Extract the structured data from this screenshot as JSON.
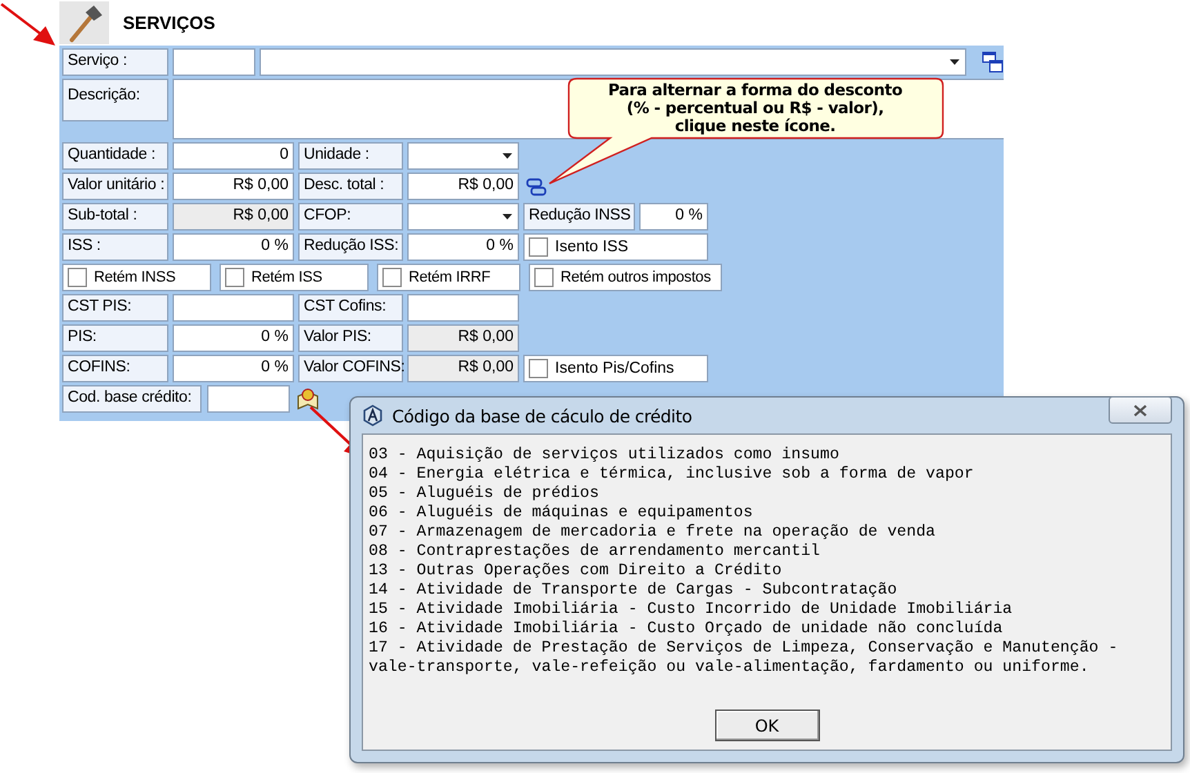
{
  "header": {
    "title": "SERVIÇOS"
  },
  "service": {
    "label": "Serviço :"
  },
  "description": {
    "label": "Descrição:"
  },
  "rows": [
    {
      "kind": "fields",
      "cells": [
        {
          "kind": "label",
          "text": "Quantidade :"
        },
        {
          "kind": "input",
          "value": "0"
        },
        {
          "kind": "label",
          "text": "Unidade :"
        },
        {
          "kind": "select"
        }
      ]
    },
    {
      "kind": "fields",
      "cells": [
        {
          "kind": "label",
          "text": "Valor unitário :"
        },
        {
          "kind": "input",
          "value": "R$ 0,00"
        },
        {
          "kind": "label",
          "text": "Desc. total :"
        },
        {
          "kind": "input",
          "value": "R$ 0,00"
        },
        {
          "kind": "toggle"
        }
      ]
    },
    {
      "kind": "fields",
      "cells": [
        {
          "kind": "label",
          "text": "Sub-total :"
        },
        {
          "kind": "readonly",
          "value": "R$ 0,00"
        },
        {
          "kind": "label",
          "text": "CFOP:"
        },
        {
          "kind": "select"
        },
        {
          "kind": "label",
          "text": "Redução INSS"
        },
        {
          "kind": "input",
          "value": "0 %"
        }
      ]
    },
    {
      "kind": "fields",
      "cells": [
        {
          "kind": "label",
          "text": "ISS :"
        },
        {
          "kind": "input",
          "value": "0 %"
        },
        {
          "kind": "label",
          "text": "Redução ISS:"
        },
        {
          "kind": "input",
          "value": "0 %"
        },
        {
          "kind": "checkbox",
          "text": "Isento ISS",
          "checked": false
        }
      ]
    },
    {
      "kind": "checks",
      "items": [
        {
          "text": "Retém INSS",
          "checked": false
        },
        {
          "text": "Retém ISS",
          "checked": false
        },
        {
          "text": "Retém IRRF",
          "checked": false
        },
        {
          "text": "Retém outros impostos",
          "checked": false
        }
      ]
    },
    {
      "kind": "fields",
      "cells": [
        {
          "kind": "label",
          "text": "CST PIS:"
        },
        {
          "kind": "input"
        },
        {
          "kind": "label",
          "text": "CST Cofins:"
        },
        {
          "kind": "input"
        }
      ]
    },
    {
      "kind": "fields",
      "cells": [
        {
          "kind": "label",
          "text": "PIS:"
        },
        {
          "kind": "input",
          "value": "0 %"
        },
        {
          "kind": "label",
          "text": "Valor PIS:"
        },
        {
          "kind": "readonly",
          "value": "R$ 0,00"
        }
      ]
    },
    {
      "kind": "fields",
      "cells": [
        {
          "kind": "label",
          "text": "COFINS:"
        },
        {
          "kind": "input",
          "value": "0 %"
        },
        {
          "kind": "label",
          "text": "Valor COFINS:"
        },
        {
          "kind": "readonly",
          "value": "R$ 0,00"
        },
        {
          "kind": "checkbox",
          "text": "Isento Pis/Cofins",
          "checked": false
        }
      ]
    }
  ],
  "credit_code": {
    "label": "Cod. base crédito:"
  },
  "tooltip": {
    "lines": [
      "Para alternar a forma do desconto",
      "(% - percentual ou R$ - valor),",
      "clique neste ícone."
    ]
  },
  "dialog": {
    "title": "Código da base de cáculo de crédito",
    "lines": [
      "03 - Aquisição de serviços utilizados como insumo",
      "04 - Energia elétrica e térmica, inclusive sob a forma de vapor",
      "05 - Aluguéis de prédios",
      "06 - Aluguéis de máquinas e equipamentos",
      "07 - Armazenagem de mercadoria e frete na operação de venda",
      "08 - Contraprestações de arrendamento mercantil",
      "13 - Outras Operações com Direito a Crédito",
      "14 - Atividade de Transporte de Cargas - Subcontratação",
      "15 - Atividade Imobiliária - Custo Incorrido de Unidade Imobiliária",
      "16 - Atividade Imobiliária - Custo Orçado de unidade não concluída",
      "17 - Atividade de Prestação de Serviços de Limpeza, Conservação e Manutenção -",
      "vale-transporte, vale-refeição ou vale-alimentação, fardamento ou uniforme."
    ],
    "button": "OK"
  }
}
